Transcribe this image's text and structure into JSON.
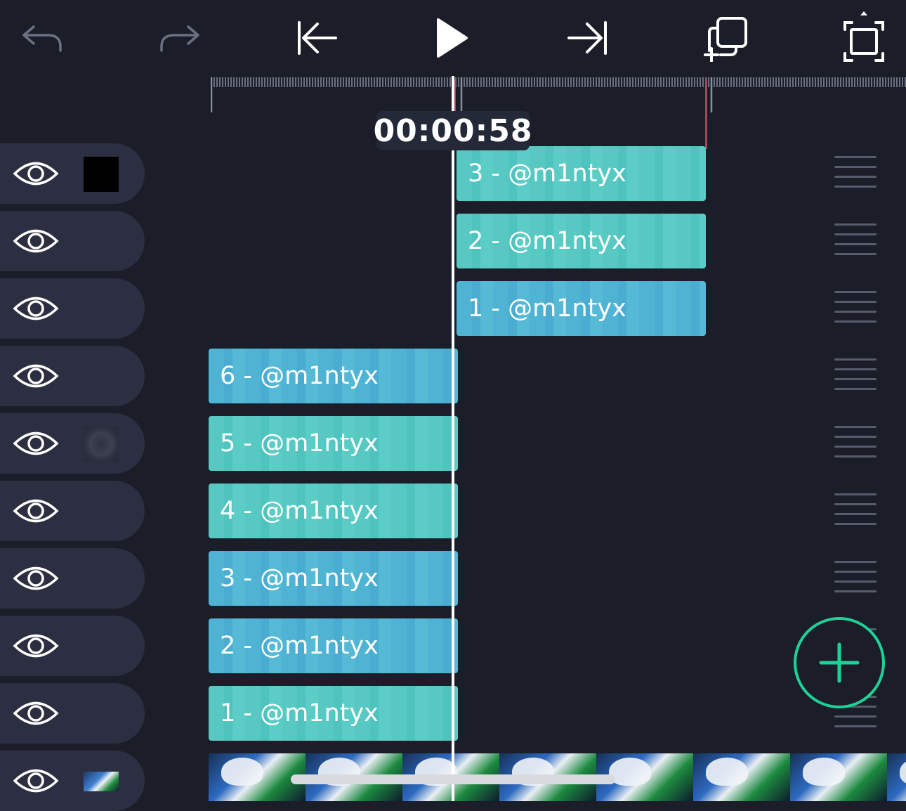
{
  "toolbar": {
    "icons": [
      "undo-icon",
      "redo-icon",
      "skip-to-start-icon",
      "play-icon",
      "skip-to-end-icon",
      "duplicate-icon",
      "fullscreen-icon"
    ]
  },
  "timeline": {
    "timecode": "00:00:58"
  },
  "layers": [
    {
      "visible": true,
      "thumb": "black-square"
    },
    {
      "visible": true,
      "thumb": "none"
    },
    {
      "visible": true,
      "thumb": "none"
    },
    {
      "visible": true,
      "thumb": "none"
    },
    {
      "visible": true,
      "thumb": "blur-circle"
    },
    {
      "visible": true,
      "thumb": "none"
    },
    {
      "visible": true,
      "thumb": "none"
    },
    {
      "visible": true,
      "thumb": "none"
    },
    {
      "visible": true,
      "thumb": "none"
    },
    {
      "visible": true,
      "thumb": "anime-image"
    }
  ],
  "clips": [
    {
      "label": "3 - @m1ntyx"
    },
    {
      "label": "2 - @m1ntyx"
    },
    {
      "label": "1 - @m1ntyx"
    },
    {
      "label": "6 - @m1ntyx"
    },
    {
      "label": "5 - @m1ntyx"
    },
    {
      "label": "4 - @m1ntyx"
    },
    {
      "label": "3 - @m1ntyx"
    },
    {
      "label": "2 - @m1ntyx"
    },
    {
      "label": "1 - @m1ntyx"
    }
  ],
  "colors": {
    "background": "#1b1d29",
    "layer_head": "#2b2f41",
    "clip_teal": "#57c9c2",
    "clip_blue": "#4fb3d4",
    "accent": "#1fd196",
    "marker": "#a8445e"
  }
}
